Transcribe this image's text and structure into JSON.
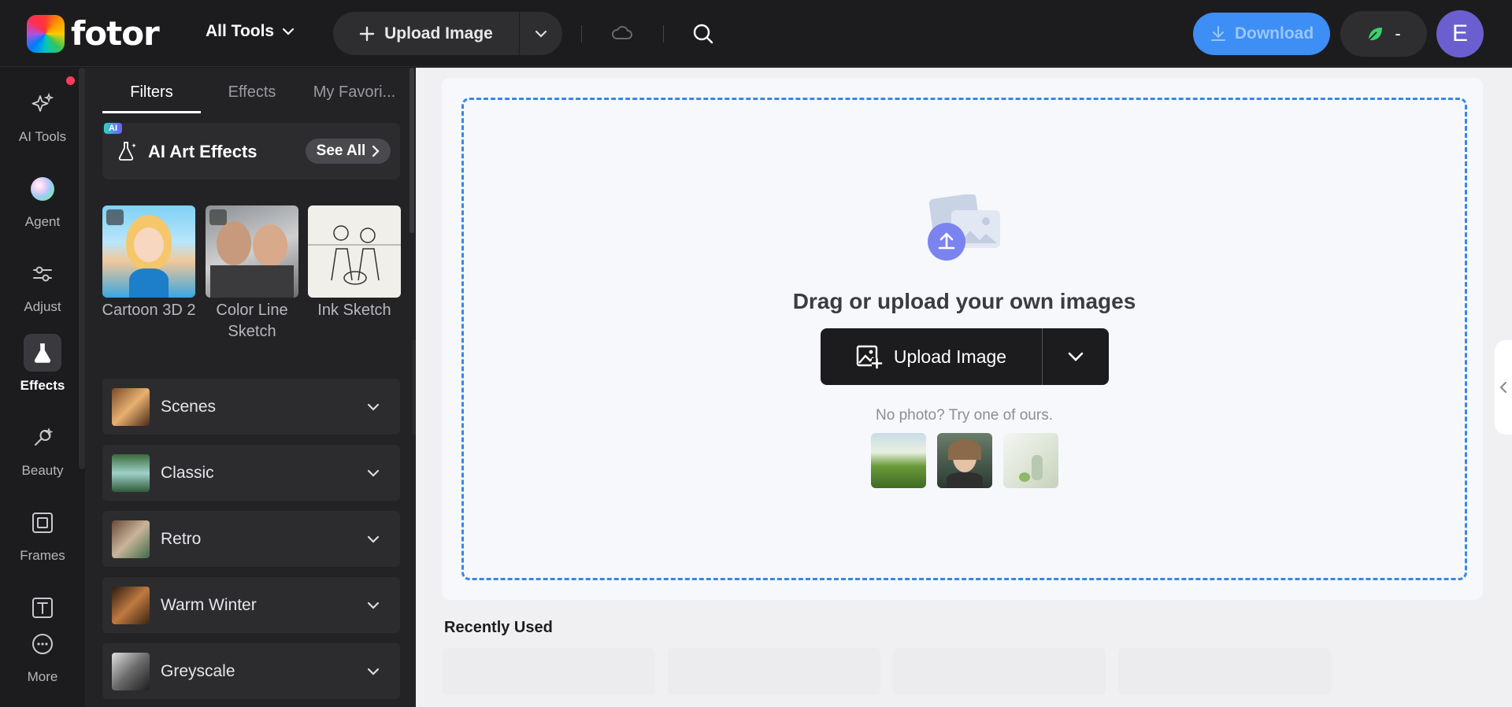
{
  "app": {
    "logo_text": "fotor"
  },
  "topbar": {
    "all_tools": "All Tools",
    "upload_label": "Upload Image",
    "download_label": "Download",
    "credits_value": "-",
    "avatar_initial": "E"
  },
  "nav": {
    "items": [
      {
        "label": "AI Tools",
        "icon": "sparkles-icon"
      },
      {
        "label": "Agent",
        "icon": "agent-orb-icon"
      },
      {
        "label": "Adjust",
        "icon": "sliders-icon"
      },
      {
        "label": "Effects",
        "icon": "flask-icon",
        "active": true
      },
      {
        "label": "Beauty",
        "icon": "beauty-icon"
      },
      {
        "label": "Frames",
        "icon": "frame-icon"
      },
      {
        "label": "More",
        "icon": "more-icon"
      }
    ]
  },
  "panel": {
    "tabs": [
      "Filters",
      "Effects",
      "My Favori..."
    ],
    "ai_badge": "AI",
    "ai_art_title": "AI Art Effects",
    "see_all": "See All",
    "thumbnails": [
      {
        "label": "Cartoon 3D 2"
      },
      {
        "label": "Color Line Sketch"
      },
      {
        "label": "Ink Sketch"
      }
    ],
    "categories": [
      "Scenes",
      "Classic",
      "Retro",
      "Warm Winter",
      "Greyscale"
    ]
  },
  "canvas": {
    "title": "Drag or upload your own images",
    "upload_label": "Upload Image",
    "no_photo": "No photo? Try one of ours."
  },
  "recent": {
    "title": "Recently Used"
  },
  "colors": {
    "accent": "#3d8ef5",
    "dropzone_border": "#3a86e8",
    "dark_bg": "#1c1c1e"
  }
}
